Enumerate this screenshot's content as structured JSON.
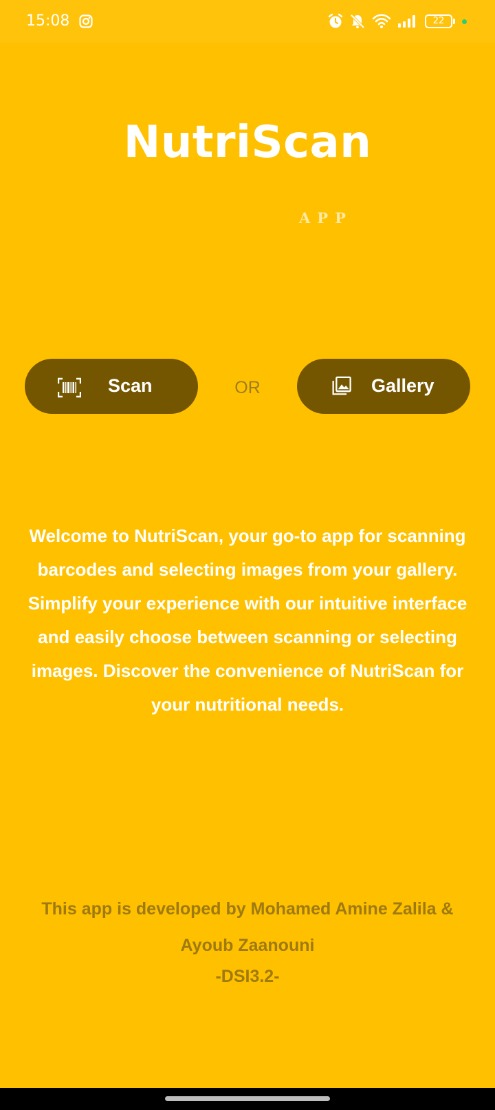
{
  "status_bar": {
    "time": "15:08",
    "battery_level": "22",
    "icons": [
      "instagram-icon",
      "alarm-icon",
      "notifications-off-icon",
      "wifi-icon",
      "signal-icon",
      "battery-icon"
    ]
  },
  "app": {
    "title": "NutriScan",
    "subtitle": "APP"
  },
  "actions": {
    "scan_label": "Scan",
    "or_label": "OR",
    "gallery_label": "Gallery"
  },
  "welcome_text": "Welcome to NutriScan, your go-to app for scanning barcodes and selecting images from your gallery. Simplify your experience with our intuitive interface and easily choose between scanning or selecting images. Discover the convenience of NutriScan for your nutritional needs.",
  "credits": {
    "developed_by": "This app is developed by Mohamed Amine Zalila & Ayoub Zaanouni",
    "class_name": "-DSI3.2-"
  },
  "colors": {
    "background": "#FFC000",
    "button": "#755600",
    "text_primary": "#FFFFFF",
    "text_muted": "#9E7A10"
  }
}
